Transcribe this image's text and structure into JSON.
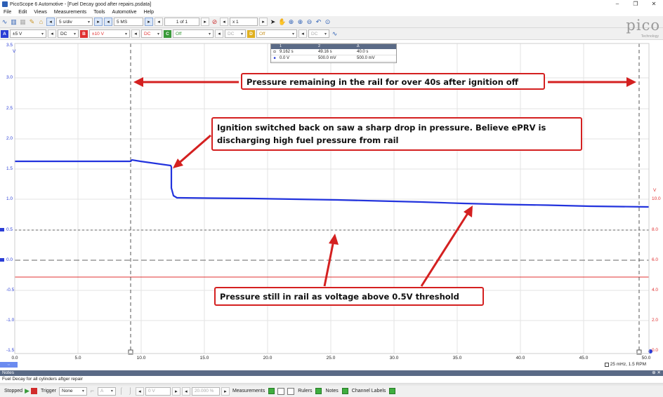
{
  "window": {
    "title": "PicoScope 6 Automotive - [Fuel Decay good after repairs.psdata]",
    "controls": [
      "–",
      "❐",
      "✕"
    ]
  },
  "menu": [
    "File",
    "Edit",
    "Views",
    "Measurements",
    "Tools",
    "Automotive",
    "Help"
  ],
  "toolbar1": {
    "timebase": "5 s/div",
    "samples": "5 MS",
    "buffer": "1 of 1",
    "zoom": "x 1"
  },
  "toolbar2": {
    "chA": {
      "label": "A",
      "range": "±5 V",
      "coupling": "DC"
    },
    "chB": {
      "label": "B",
      "range": "±10 V",
      "coupling": "DC"
    },
    "chC": {
      "label": "C",
      "range": "Off"
    },
    "chD": {
      "label": "D",
      "range": "Off",
      "coupling": "DC"
    }
  },
  "logo": {
    "text": "pico",
    "sub": "Technology"
  },
  "measure_panel": {
    "headers": [
      "1",
      "2",
      "Δ"
    ],
    "rows": [
      {
        "c1": "9.162 s",
        "c2": "49.16 s",
        "c3": "40.0 s"
      },
      {
        "c1": "0.0 V",
        "c2": "500.0 mV",
        "c3": "500.0 mV"
      }
    ]
  },
  "y_axis_left": {
    "unit": "V",
    "ticks": [
      "3.5",
      "3.0",
      "2.5",
      "2.0",
      "1.5",
      "1.0",
      "0.5",
      "0.0",
      "-0.5",
      "-1.0",
      "-1.5"
    ]
  },
  "y_axis_right": {
    "unit": "V",
    "ticks": [
      "10.0",
      "8.0",
      "6.0",
      "4.0",
      "2.0",
      "0.0"
    ]
  },
  "x_axis": {
    "ticks": [
      "0.0",
      "5.0",
      "10.0",
      "15.0",
      "20.0",
      "25.0",
      "30.0",
      "35.0",
      "40.0",
      "45.0",
      "50.0"
    ]
  },
  "annotations": {
    "top": "Pressure remaining in the rail for over 40s after ignition off",
    "mid": "Ignition switched back on saw a sharp drop in pressure. Believe ePRV is discharging high fuel pressure from rail",
    "bottom": "Pressure still in rail as voltage above 0.5V threshold"
  },
  "zoom_info": "25 mHz, 1.5 RPM",
  "notes": {
    "header": "Notes",
    "body": "Fuel Decay for all cylinders aftger repair"
  },
  "status": {
    "state": "Stopped",
    "trigger_label": "Trigger",
    "trigger_value": "None",
    "trigger_ch": "A",
    "level": "0 V",
    "pretrigger": "20.000 %",
    "measurements": "Measurements",
    "rulers": "Rulers",
    "notes": "Notes",
    "channel_labels": "Channel Labels"
  },
  "colors": {
    "chA": "#2b3ed6",
    "chB": "#e03030",
    "callout": "#d42020"
  }
}
